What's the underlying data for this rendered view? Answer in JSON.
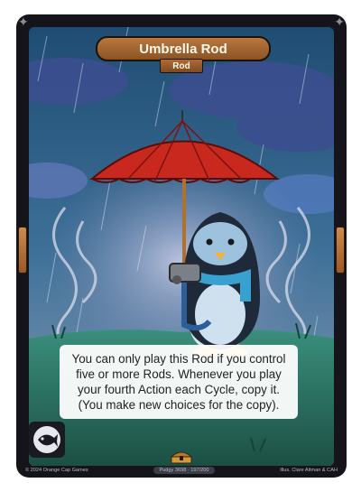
{
  "card": {
    "title": "Umbrella Rod",
    "type": "Rod",
    "rules_text": [
      "You can only play this Rod if you control",
      "five or more Rods. Whenever you play",
      "your fourth Action each Cycle, copy it.",
      "(You make new choices for the copy)."
    ],
    "copyright": "© 2024 Orange Cap Games",
    "set_info": "Pudgy 3698 · 197/200",
    "illustrator": "Illus. Clare Altman & CAH",
    "faction_icon": "white-fish-icon",
    "rarity_icon": "treasure-chest-icon"
  },
  "colors": {
    "frame": "#14141a",
    "title_bar": "#a86833",
    "sky": "#2e5d86",
    "umbrella": "#c8281e",
    "grass": "#2f7f6e",
    "scarf": "#3aa0d0",
    "penguin": "#1e2a3a"
  }
}
